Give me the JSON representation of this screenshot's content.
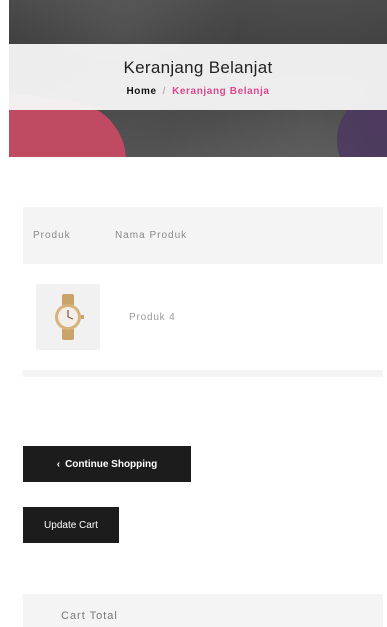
{
  "header": {
    "title": "Keranjang Belanjat",
    "breadcrumb": {
      "home": "Home",
      "separator": "/",
      "current": "Keranjang Belanja"
    }
  },
  "cart": {
    "columns": [
      "Produk",
      "Nama Produk"
    ],
    "items": [
      {
        "name": "Produk 4",
        "image_icon": "wristwatch-icon"
      }
    ]
  },
  "actions": {
    "continue_label": "Continue Shopping",
    "continue_icon": "chevron-left-icon",
    "update_label": "Update Cart"
  },
  "totals": {
    "title": "Cart Total"
  },
  "colors": {
    "accent": "#d9498f",
    "button_bg": "#1c1c1c",
    "table_bg": "#f4f4f4"
  }
}
